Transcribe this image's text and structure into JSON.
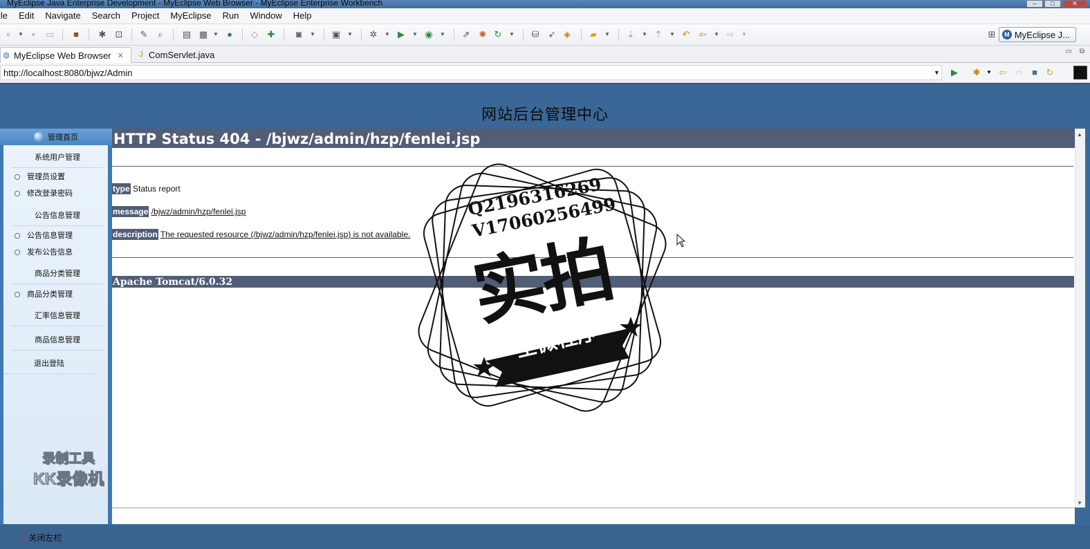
{
  "window": {
    "title": "MyEclipse Java Enterprise Development - MyEclipse Web Browser - MyEclipse Enterprise Workbench",
    "controls": [
      "–",
      "□",
      "✕"
    ]
  },
  "menu": [
    "ile",
    "Edit",
    "Navigate",
    "Search",
    "Project",
    "MyEclipse",
    "Run",
    "Window",
    "Help"
  ],
  "perspective": {
    "label": "MyEclipse J..."
  },
  "tabs": [
    {
      "label": "MyEclipse Web Browser",
      "active": true,
      "close": "✕"
    },
    {
      "label": "ComServlet.java",
      "active": false
    }
  ],
  "address": {
    "url": "http://localhost:8080/bjwz/Admin"
  },
  "site": {
    "title": "网站后台管理中心",
    "sidebar": {
      "home": "管理首页",
      "sections": [
        {
          "title": "系统用户管理",
          "items": [
            "管理员设置",
            "修改登录密码"
          ]
        },
        {
          "title": "公告信息管理",
          "items": [
            "公告信息管理",
            "发布公告信息"
          ]
        },
        {
          "title": "商品分类管理",
          "items": [
            "商品分类管理"
          ]
        },
        {
          "title": "汇率信息管理",
          "items": []
        },
        {
          "title": "商品信息管理",
          "items": []
        },
        {
          "title": "退出登陆",
          "items": []
        }
      ]
    },
    "footer_link": "关闭左栏"
  },
  "error_page": {
    "heading": "HTTP Status 404 - /bjwz/admin/hzp/fenlei.jsp",
    "type_label": "type",
    "type_value": "Status report",
    "message_label": "message",
    "message_value": "/bjwz/admin/hzp/fenlei.jsp",
    "description_label": "description",
    "description_value": "The requested resource (/bjwz/admin/hzp/fenlei.jsp) is not available.",
    "server": "Apache Tomcat/6.0.32"
  },
  "watermarks": {
    "stamp_line1": "Q2196316269",
    "stamp_line2": "V17060256499",
    "stamp_big": "实拍",
    "stamp_ribbon": "全微程序",
    "recorder_line1": "录制工具",
    "recorder_line2": "KK录像机"
  }
}
